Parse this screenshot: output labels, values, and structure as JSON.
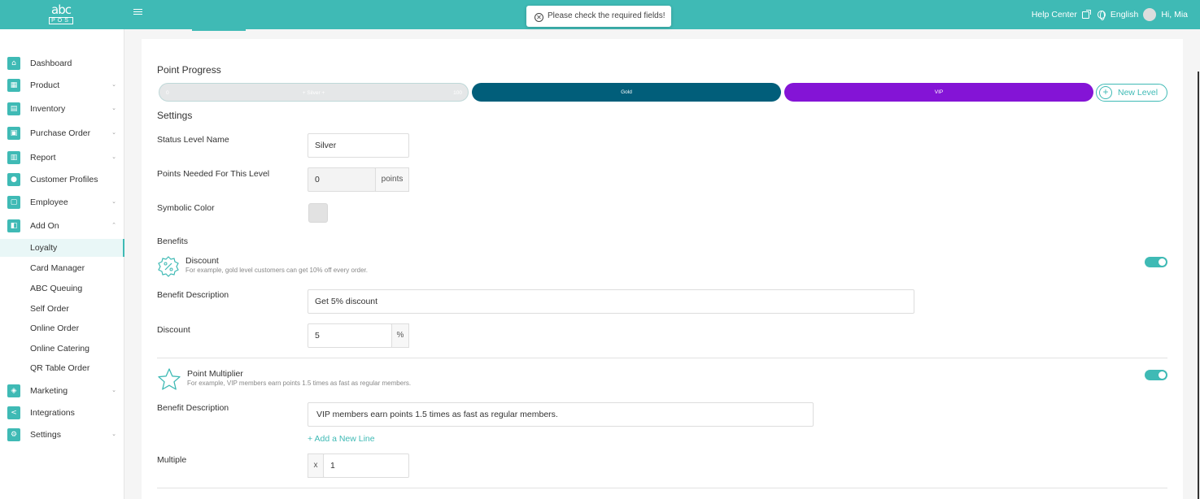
{
  "header": {
    "logo_top": "abc",
    "logo_bottom": "POS",
    "toast": "Please check the required fields!",
    "help_center": "Help Center",
    "language": "English",
    "greeting": "Hi, Mia",
    "bg_color": "#3fbab5"
  },
  "sidebar": {
    "items": [
      {
        "label": "Dashboard",
        "icon": "home-icon"
      },
      {
        "label": "Product",
        "icon": "grid-icon"
      },
      {
        "label": "Inventory",
        "icon": "clipboard-icon"
      },
      {
        "label": "Purchase Order",
        "icon": "calculator-icon"
      },
      {
        "label": "Report",
        "icon": "chart-icon"
      },
      {
        "label": "Customer Profiles",
        "icon": "users-icon"
      },
      {
        "label": "Employee",
        "icon": "id-card-icon"
      },
      {
        "label": "Add On",
        "icon": "addon-icon"
      },
      {
        "label": "Marketing",
        "icon": "megaphone-icon"
      },
      {
        "label": "Integrations",
        "icon": "share-icon"
      },
      {
        "label": "Settings",
        "icon": "gear-icon"
      }
    ],
    "sub_items": [
      "Loyalty",
      "Card Manager",
      "ABC Queuing",
      "Self Order",
      "Online Order",
      "Online Catering",
      "QR Table Order"
    ],
    "active": "Loyalty"
  },
  "main": {
    "point_progress_title": "Point Progress",
    "levels": [
      {
        "name": "Silver",
        "label": "+ Silver +",
        "min": "0",
        "max": "100",
        "color": "#e5e7e8"
      },
      {
        "name": "Gold",
        "label": "Gold",
        "color": "#015e7a"
      },
      {
        "name": "VIP",
        "label": "VIP",
        "color": "#8414d6"
      }
    ],
    "new_level": "New Level",
    "settings_title": "Settings",
    "status_level_label": "Status Level Name",
    "status_level_value": "Silver",
    "points_needed_label": "Points Needed For This Level",
    "points_needed_value": "0",
    "points_unit": "points",
    "symbolic_color_label": "Symbolic Color",
    "benefits_title": "Benefits",
    "discount": {
      "title": "Discount",
      "subtitle": "For example, gold level customers can get 10% off every order.",
      "desc_label": "Benefit Description",
      "desc_value": "Get 5% discount",
      "discount_label": "Discount",
      "discount_value": "5",
      "unit": "%",
      "enabled": true
    },
    "multiplier": {
      "title": "Point Multiplier",
      "subtitle": "For example, VIP members earn points 1.5 times as fast as regular members.",
      "desc_label": "Benefit Description",
      "desc_value": "VIP members earn points 1.5 times as fast as regular members.",
      "add_line": "+ Add a New Line",
      "multiple_label": "Multiple",
      "prefix": "x",
      "multiple_value": "1",
      "enabled": true
    }
  }
}
